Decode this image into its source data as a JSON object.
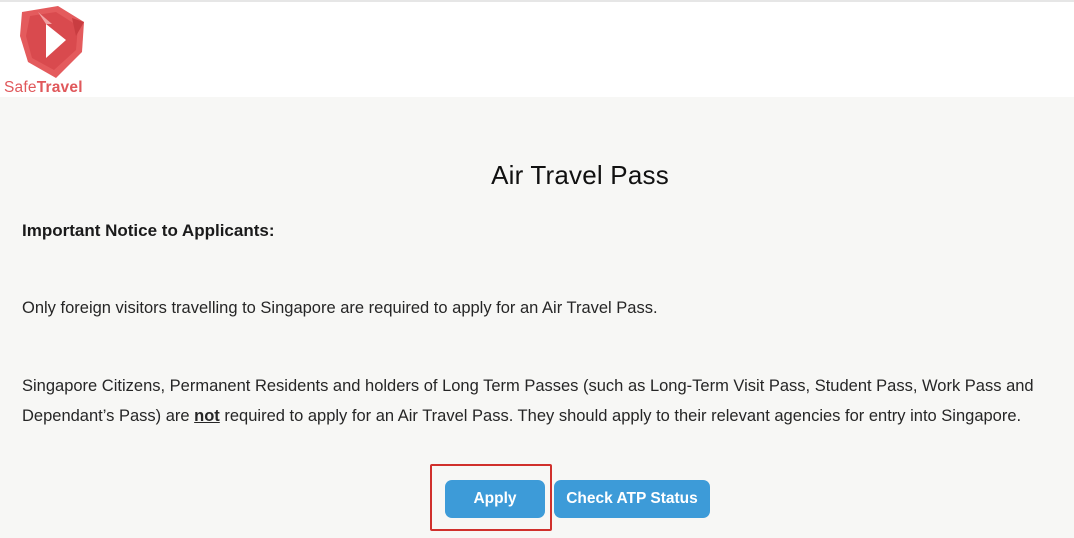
{
  "brand": {
    "name_part1": "Safe",
    "name_part2": "Travel",
    "color": "#e0585b"
  },
  "page": {
    "title": "Air Travel Pass",
    "notice_heading": "Important Notice to Applicants:",
    "paragraph_1": "Only foreign visitors travelling to Singapore are required to apply for an Air Travel Pass.",
    "paragraph_2_before": "Singapore Citizens, Permanent Residents and holders of Long Term Passes (such as Long-Term Visit Pass, Student Pass, Work Pass and Dependant’s Pass) are ",
    "paragraph_2_emph": "not",
    "paragraph_2_after": " required to apply for an Air Travel Pass. They should apply to their relevant agencies for entry into Singapore."
  },
  "actions": {
    "apply_label": "Apply",
    "check_status_label": "Check ATP Status",
    "button_color": "#3d9bd8",
    "highlight_color": "#d0302c"
  }
}
